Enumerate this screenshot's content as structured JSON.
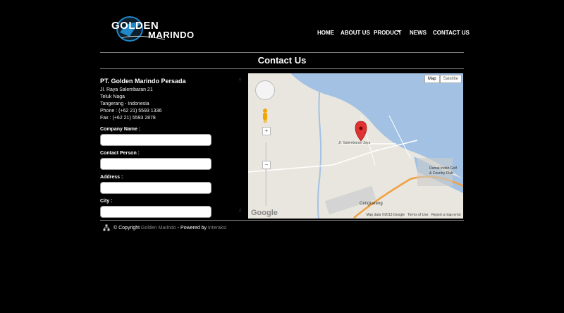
{
  "logo": {
    "line1": "GOLDEN",
    "line2": "MARINDO",
    "accent": "#1e88c8"
  },
  "nav": {
    "items": [
      "HOME",
      "ABOUT US",
      "PRODUCT",
      "NEWS",
      "CONTACT US"
    ]
  },
  "page": {
    "title": "Contact Us"
  },
  "company": {
    "name": "PT. Golden Marindo Persada",
    "address1": "Jl. Raya Salembaran 21",
    "address2": "Teluk Naga",
    "address3": "Tangerang - Indonesia",
    "phone": "Phone :  (+62 21) 5593 1336",
    "fax": "Fax     :  (+62 21) 5593  2878"
  },
  "form": {
    "company_name": "Company Name :",
    "contact_person": "Contact Person :",
    "address": "Address :",
    "city": "City :"
  },
  "map": {
    "type_map": "Map",
    "type_satellite": "Satellite",
    "road_label": "Jl. Salembaran Jaya",
    "place_cengkareng": "Cengkareng",
    "place_damai": "Damai Indah Golf",
    "place_country": "& Country Club",
    "attribution_data": "Map data ©2013 Google",
    "attribution_terms": "Terms of Use",
    "attribution_report": "Report a map error",
    "google": "Google",
    "colors": {
      "water": "#a3c2e3",
      "land": "#e8e6df",
      "marker": "#d33"
    }
  },
  "footer": {
    "prefix": "© Copyright",
    "brand": "Golden Marindo",
    "mid": " - Powered by ",
    "powered": "Interaksi"
  }
}
